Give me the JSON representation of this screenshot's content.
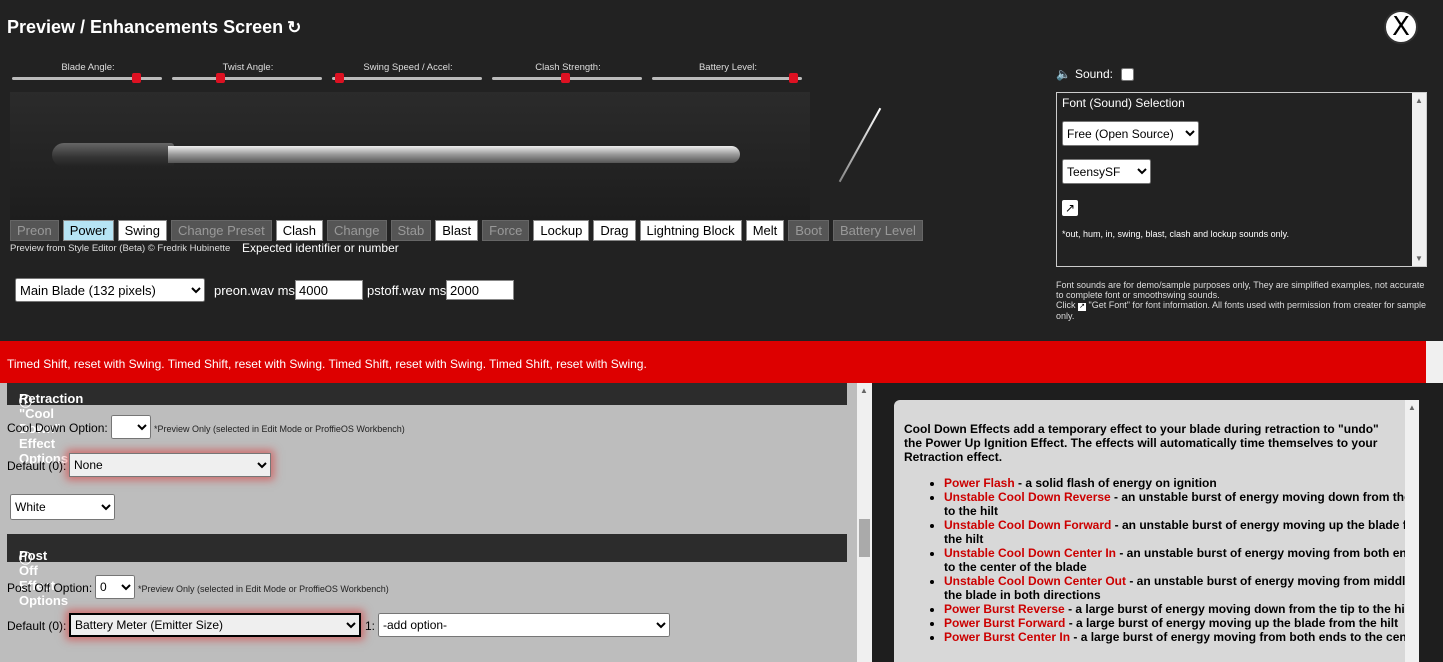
{
  "title": "Preview / Enhancements Screen",
  "close_label": "X",
  "sliders": [
    {
      "label": "Blade Angle:",
      "value": 0.85
    },
    {
      "label": "Twist Angle:",
      "value": 0.31
    },
    {
      "label": "Swing Speed / Accel:",
      "value": 0.02
    },
    {
      "label": "Clash Strength:",
      "value": 0.49
    },
    {
      "label": "Battery Level:",
      "value": 0.97
    }
  ],
  "effect_buttons": [
    {
      "label": "Preon",
      "state": "disabled"
    },
    {
      "label": "Power",
      "state": "active"
    },
    {
      "label": "Swing",
      "state": "normal"
    },
    {
      "label": "Change Preset",
      "state": "disabled"
    },
    {
      "label": "Clash",
      "state": "normal"
    },
    {
      "label": "Change",
      "state": "disabled"
    },
    {
      "label": "Stab",
      "state": "disabled"
    },
    {
      "label": "Blast",
      "state": "normal"
    },
    {
      "label": "Force",
      "state": "disabled"
    },
    {
      "label": "Lockup",
      "state": "normal"
    },
    {
      "label": "Drag",
      "state": "normal"
    },
    {
      "label": "Lightning Block",
      "state": "normal"
    },
    {
      "label": "Melt",
      "state": "normal"
    },
    {
      "label": "Boot",
      "state": "disabled"
    },
    {
      "label": "Battery Level",
      "state": "disabled"
    }
  ],
  "credit": "Preview from Style Editor (Beta) © Fredrik Hubinette",
  "error_text": "Expected identifier or number",
  "blade_select": "Main Blade (132 pixels)",
  "preon_label": "preon.wav ms:",
  "preon_value": "4000",
  "pstoff_label": "pstoff.wav ms:",
  "pstoff_value": "2000",
  "sound_label": "Sound:",
  "font_box": {
    "header": "Font (Sound) Selection",
    "select1": "Free (Open Source)",
    "select2": "TeensySF",
    "note": "*out, hum, in, swing, blast, clash and lockup sounds only."
  },
  "font_disclaimer_1": "Font sounds are for demo/sample purposes only, They are simplified examples, not accurate to complete font or smoothswing sounds.",
  "font_disclaimer_2": "Click",
  "font_disclaimer_3": "\"Get Font\" for font information. All fonts used with permission from creater for sample only.",
  "banner_text": "Timed Shift, reset with Swing. Timed Shift, reset with Swing. Timed Shift, reset with Swing. Timed Shift, reset with Swing.",
  "cooldown": {
    "header": "Retraction \"Cool Down\" Effect Options",
    "option_label": "Cool Down Option:",
    "option_value": "",
    "note": "*Preview Only (selected in Edit Mode or ProffieOS Workbench)",
    "default_label": "Default (0):",
    "default_value": "None",
    "color_value": "White"
  },
  "postoff": {
    "header": "Post Off Effect Options",
    "option_label": "Post Off Option:",
    "option_value": "0",
    "note": "*Preview Only (selected in Edit Mode or ProffieOS Workbench)",
    "default_label": "Default (0):",
    "default_value": "Battery Meter (Emitter Size)",
    "one_label": "1:",
    "add_option": "-add option-"
  },
  "info": {
    "intro": "Cool Down Effects add a temporary effect to your blade during retraction to \"undo\" the Power Up Ignition Effect. The effects will automatically time themselves to your Retraction effect.",
    "items": [
      {
        "name": "Power Flash",
        "desc": " - a solid flash of energy on ignition"
      },
      {
        "name": "Unstable Cool Down Reverse",
        "desc": " - an unstable burst of energy moving down from the tip to the hilt"
      },
      {
        "name": "Unstable Cool Down Forward",
        "desc": " - an unstable burst of energy moving up the blade from the hilt"
      },
      {
        "name": "Unstable Cool Down Center In",
        "desc": " - an unstable burst of energy moving from both ends to the center of the blade"
      },
      {
        "name": "Unstable Cool Down Center Out",
        "desc": " - an unstable burst of energy moving from middle of the blade in both directions"
      },
      {
        "name": "Power Burst Reverse",
        "desc": " - a large burst of energy moving down from the tip to the hilt"
      },
      {
        "name": "Power Burst Forward",
        "desc": " - a large burst of energy moving up the blade from the hilt"
      },
      {
        "name": "Power Burst Center In",
        "desc": " - a large burst of energy moving from both ends to the center"
      }
    ]
  },
  "colors": {
    "banner": "#dd0000",
    "slider_thumb": "#dd1122",
    "link_red": "#cc0000",
    "active_button": "#b6e4f4"
  }
}
